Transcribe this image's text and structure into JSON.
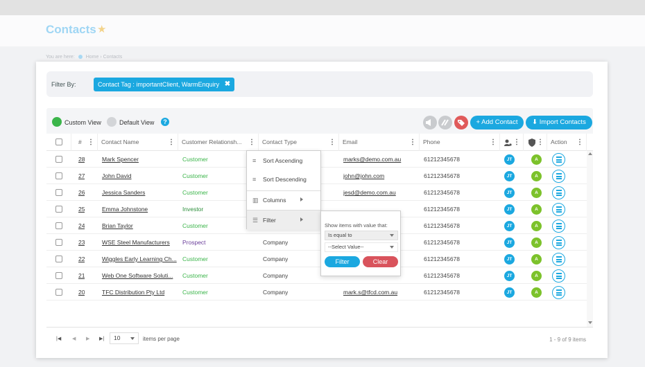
{
  "app": {
    "title": "Contacts",
    "breadcrumb": {
      "prefix": "You are here:",
      "home": "Home",
      "sep": "›",
      "current": "Contacts"
    }
  },
  "filter": {
    "label": "Filter By:",
    "chip": "Contact Tag : importantClient, WarmEnquiry"
  },
  "toolbar": {
    "custom_view": "Custom View",
    "default_view": "Default View",
    "help": "?",
    "add_contact": "+ Add Contact",
    "import_contacts": "Import Contacts",
    "colors": {
      "grey": "#c9cbce",
      "red": "#e05a5a",
      "accent": "#1ba8e0",
      "green": "#3bb54a"
    }
  },
  "columns": {
    "num": "#",
    "name": "Contact Name",
    "relationship": "Customer Relationsh...",
    "type": "Contact Type",
    "email": "Email",
    "phone": "Phone",
    "action": "Action"
  },
  "rows": [
    {
      "num": "28",
      "name": "Mark Spencer",
      "rel": "Customer",
      "type": "",
      "email": "marks@demo.com.au",
      "phone": "61212345678",
      "owner": "JT",
      "status": "A"
    },
    {
      "num": "27",
      "name": "John David",
      "rel": "Customer",
      "type": "",
      "email": "john@john.com",
      "phone": "61212345678",
      "owner": "JT",
      "status": "A"
    },
    {
      "num": "26",
      "name": "Jessica Sanders",
      "rel": "Customer",
      "type": "",
      "email": "jesd@demo.com.au",
      "phone": "61212345678",
      "owner": "JT",
      "status": "A"
    },
    {
      "num": "25",
      "name": "Emma Johnstone",
      "rel": "Investor",
      "type": "",
      "email": "",
      "phone": "61212345678",
      "owner": "JT",
      "status": "A"
    },
    {
      "num": "24",
      "name": "Brian Taylor",
      "rel": "Customer",
      "type": "",
      "email": "",
      "phone": "61212345678",
      "owner": "JT",
      "status": "A"
    },
    {
      "num": "23",
      "name": "WSE Steel Manufacturers",
      "rel": "Prospect",
      "type": "Company",
      "email": "",
      "phone": "61212345678",
      "owner": "JT",
      "status": "A"
    },
    {
      "num": "22",
      "name": "Wiggles Early Learning Ch...",
      "rel": "Customer",
      "type": "Company",
      "email": "",
      "phone": "61212345678",
      "owner": "JT",
      "status": "A"
    },
    {
      "num": "21",
      "name": "Web One Software Soluti...",
      "rel": "Customer",
      "type": "Company",
      "email": "",
      "phone": "61212345678",
      "owner": "JT",
      "status": "A"
    },
    {
      "num": "20",
      "name": "TFC Distribution Pty Ltd",
      "rel": "Customer",
      "type": "Company",
      "email": "mark.s@tfcd.com.au",
      "phone": "61212345678",
      "owner": "JT",
      "status": "A"
    }
  ],
  "column_menu": {
    "sort_asc": "Sort Ascending",
    "sort_desc": "Sort Descending",
    "columns": "Columns",
    "filter": "Filter"
  },
  "filter_menu": {
    "title": "Show items with value that:",
    "operator": "Is equal to",
    "value_placeholder": "--Select Value--",
    "filter_button": "Filter",
    "clear_button": "Clear"
  },
  "pager": {
    "page_size": "10",
    "items_per_page": "items per page",
    "info": "1 - 9 of 9 items"
  }
}
